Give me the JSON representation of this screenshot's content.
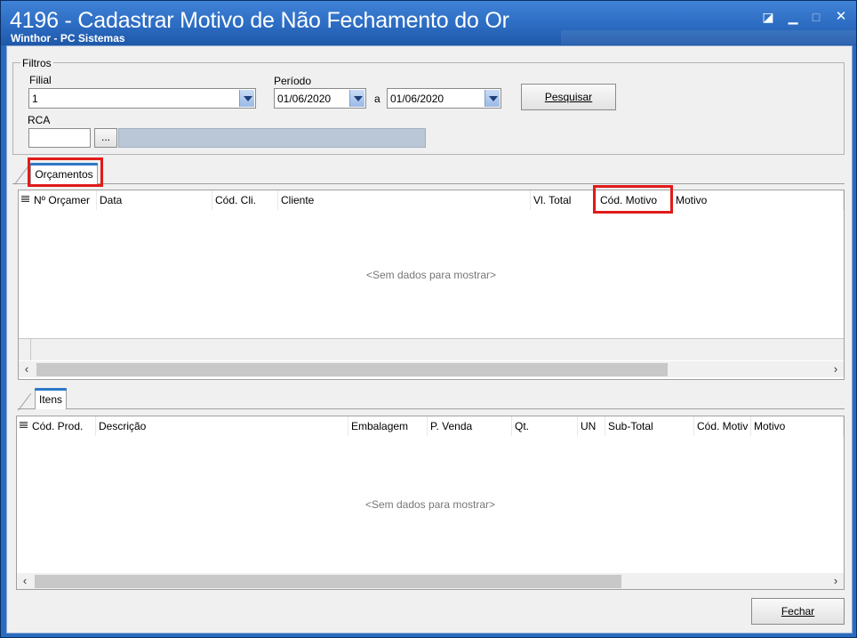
{
  "window": {
    "title": "4196 - Cadastrar Motivo de Não Fechamento do Or",
    "subtitle": "Winthor - PC Sistemas",
    "controls": {
      "restore": "◪",
      "minimize": "▁",
      "maximize": "□",
      "close": "✕"
    }
  },
  "filters": {
    "legend": "Filtros",
    "filial_label": "Filial",
    "filial_value": "1",
    "periodo_label": "Período",
    "date_from": "01/06/2020",
    "between_label": "a",
    "date_to": "01/06/2020",
    "search_button": "Pesquisar",
    "rca_label": "RCA",
    "rca_value": "",
    "rca_lookup_button": "...",
    "rca_description": ""
  },
  "orcamentos": {
    "tab_label": "Orçamentos",
    "columns": [
      "Nº Orçamer",
      "Data",
      "Cód. Cli.",
      "Cliente",
      "Vl. Total",
      "Cód. Motivo",
      "Motivo"
    ],
    "empty_text": "<Sem dados para mostrar>",
    "highlight_column": "Cód. Motivo"
  },
  "itens": {
    "tab_label": "Itens",
    "columns": [
      "Cód. Prod.",
      "Descrição",
      "Embalagem",
      "P. Venda",
      "Qt.",
      "UN",
      "Sub-Total",
      "Cód. Motiv",
      "Motivo"
    ],
    "empty_text": "<Sem dados para mostrar>"
  },
  "footer": {
    "close_button": "Fechar"
  },
  "colors": {
    "titlebar": "#2c6cc2",
    "highlight": "#e21a1a",
    "tab_accent": "#2d78c8"
  },
  "icons": [
    "column-chooser-icon",
    "scroll-left-icon",
    "scroll-right-icon",
    "dropdown-arrow-icon"
  ]
}
